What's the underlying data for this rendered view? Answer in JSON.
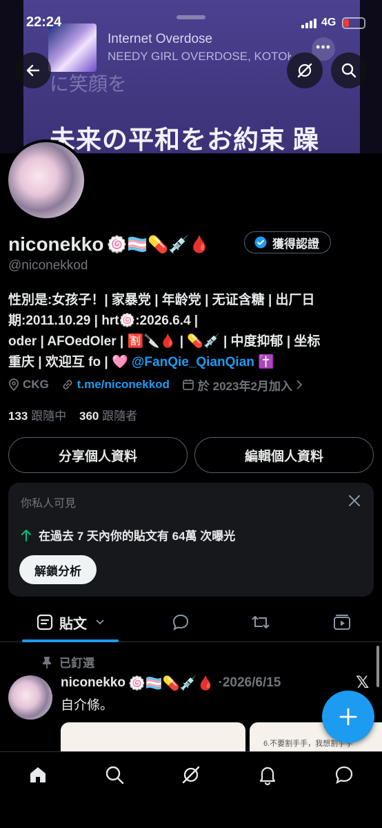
{
  "status_bar": {
    "time": "22:24",
    "network": "4G",
    "battery_level": 0.25
  },
  "now_playing": {
    "title": "Internet Overdose",
    "artist": "NEEDY GIRL OVERDOSE, KOTOKO",
    "lyric_faint": "に笑顔を",
    "lyric_main": "未来の平和をお約束 躁",
    "more_label": "•••"
  },
  "profile": {
    "display_name": "niconekko",
    "name_emojis": "🍥🏳️‍⚧️💊💉🩸",
    "verify_label": "獲得認證",
    "handle": "@niconekkod",
    "bio_lines": [
      "性別是:女孩子！| 家暴党 | 年龄党 | 无证含糖 | 出厂日",
      "期:2011.10.29 | hrt🍥:2026.6.4 |",
      "oder | AFOedOler | 🈹🔪🩸 | 💊💉 | 中度抑郁 | 坐标",
      "重庆 | 欢迎互 fo | 🩷"
    ],
    "bio_mention": "@FanQie_QianQian",
    "bio_tail_emoji": "✝️",
    "location": "CKG",
    "link": "t.me/niconekkod",
    "joined": "於 2023年2月加入",
    "following_count": "133",
    "following_label": "跟隨中",
    "followers_count": "360",
    "followers_label": "跟隨者"
  },
  "buttons": {
    "share": "分享個人資料",
    "edit": "編輯個人資料"
  },
  "insight_card": {
    "header": "你私人可見",
    "stat": "在過去 7 天內你的貼文有 64萬 次曝光",
    "unlock": "解鎖分析"
  },
  "tabs": {
    "posts": "貼文"
  },
  "pinned_post": {
    "pinned_label": "已釘選",
    "author": "niconekko",
    "author_emojis": "🍥🏳️‍⚧️💊💉🩸",
    "date": "·2026/6/15",
    "text": "自介條。",
    "image2_text": "6.不要割手手，我想割手手"
  },
  "colors": {
    "accent": "#1d9bf0",
    "background": "#000000",
    "muted": "#71767b",
    "card": "#16181c"
  },
  "icons": [
    "back-arrow-icon",
    "grok-icon",
    "search-icon",
    "location-icon",
    "link-icon",
    "calendar-icon",
    "chevron-right-icon",
    "verified-badge-icon",
    "close-icon",
    "arrow-up-icon",
    "posts-icon",
    "chevron-down-icon",
    "replies-icon",
    "reposts-icon",
    "media-icon",
    "pin-icon",
    "x-logo-icon",
    "plus-icon",
    "home-icon",
    "explore-icon",
    "notifications-icon",
    "messages-icon"
  ]
}
